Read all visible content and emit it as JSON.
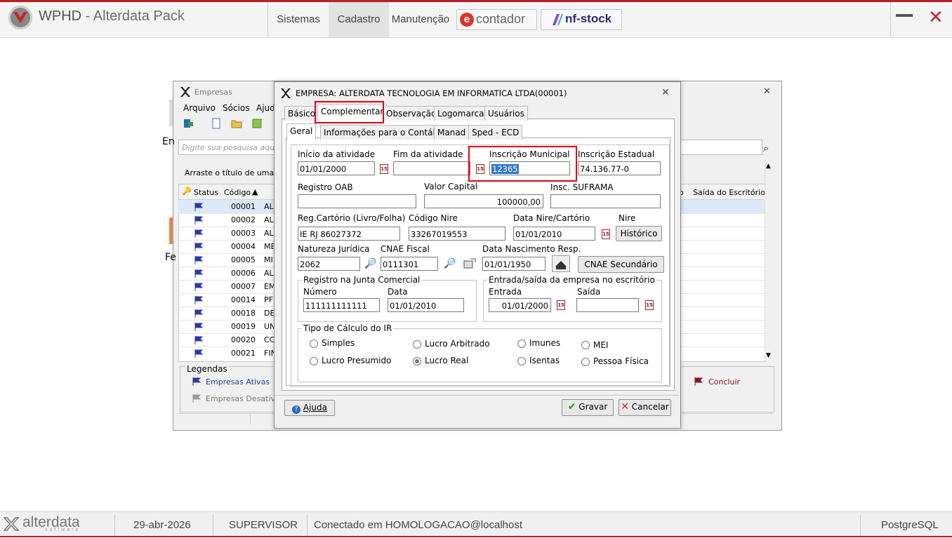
{
  "app": {
    "title_bold": "WPHD",
    "title_rest": " - Alterdata Pack"
  },
  "nav": {
    "sistemas": "Sistemas",
    "cadastro": "Cadastro",
    "manutencao": "Manutenção",
    "contador": "contador",
    "nfstock": "nf-stock"
  },
  "empresas_window": {
    "title": "Empresas",
    "menu": [
      "Arquivo",
      "Sócios",
      "Ajud"
    ],
    "search_placeholder": "Digite sua pesquisa aqui...",
    "group_hint": "Arraste o título de uma colu",
    "columns": {
      "status": "Status",
      "codigo": "Código",
      "saida": "Saída do Escritório",
      "partial": "o"
    },
    "left_partial_1": "En",
    "left_partial_2": "Fe",
    "rows": [
      {
        "codigo": "00001",
        "nome": "AL"
      },
      {
        "codigo": "00002",
        "nome": "AL"
      },
      {
        "codigo": "00003",
        "nome": "AL"
      },
      {
        "codigo": "00004",
        "nome": "ME"
      },
      {
        "codigo": "00005",
        "nome": "MI"
      },
      {
        "codigo": "00006",
        "nome": "AL"
      },
      {
        "codigo": "00007",
        "nome": "EM"
      },
      {
        "codigo": "00014",
        "nome": "PF"
      },
      {
        "codigo": "00018",
        "nome": "DE"
      },
      {
        "codigo": "00019",
        "nome": "UN"
      },
      {
        "codigo": "00020",
        "nome": "CC"
      },
      {
        "codigo": "00021",
        "nome": "FIN"
      }
    ],
    "legend_title": "Legendas",
    "legend_active": "Empresas Ativas",
    "legend_inactive": "Empresas Desativad",
    "concluir": "Concluir"
  },
  "dialog": {
    "title": "EMPRESA: ALTERDATA TECNOLOGIA EM INFORMATICA LTDA(00001)",
    "tabs": [
      "Básico",
      "Complementar",
      "Observação",
      "Logomarca",
      "Usuários"
    ],
    "subtabs": [
      "Geral",
      "Informações para o Contábil",
      "Manad",
      "Sped - ECD"
    ],
    "fields": {
      "inicio_label": "Início da atividade",
      "inicio_value": "01/01/2000",
      "fim_label": "Fim da atividade",
      "fim_value": "",
      "im_label": "Inscrição Municipal",
      "im_value": "12365",
      "ie_label": "Inscrição Estadual",
      "ie_value": "74.136.77-0",
      "oab_label": "Registro OAB",
      "oab_value": "",
      "capital_label": "Valor Capital",
      "capital_value": "100000,00",
      "suframa_label": "Insc. SUFRAMA",
      "suframa_value": "",
      "cartorio_label": "Reg.Cartório (Livro/Folha)",
      "cartorio_value": "IE RJ 86027372",
      "nire_label": "Código Nire",
      "nire_value": "33267019553",
      "data_nire_label": "Data Nire/Cartório",
      "data_nire_value": "01/01/2010",
      "nire_hist_label": "Nire",
      "historico_btn": "Histórico",
      "natureza_label": "Natureza Jurídica",
      "natureza_value": "2062",
      "cnae_label": "CNAE Fiscal",
      "cnae_value": "0111301",
      "nasc_label": "Data Nascimento Resp.",
      "nasc_value": "01/01/1950",
      "cnae_sec_btn": "CNAE Secundário"
    },
    "junta": {
      "title": "Registro na Junta Comercial",
      "numero_label": "Número",
      "numero_value": "111111111111",
      "data_label": "Data",
      "data_value": "01/01/2010"
    },
    "escritorio": {
      "title": "Entrada/saída da empresa no escritório",
      "entrada_label": "Entrada",
      "entrada_value": "01/01/2000",
      "saida_label": "Saída",
      "saida_value": ""
    },
    "ir": {
      "title": "Tipo de Cálculo do IR",
      "options": [
        "Simples",
        "Lucro Arbitrado",
        "Imunes",
        "MEI",
        "Lucro Presumido",
        "Lucro Real",
        "Isentas",
        "Pessoa Física"
      ],
      "selected": "Lucro Real"
    },
    "buttons": {
      "ajuda": "Ajuda",
      "gravar": "Gravar",
      "cancelar": "Cancelar"
    }
  },
  "status": {
    "brand": "alterdata",
    "brand_sub": "software",
    "date": "29-abr-2026",
    "user": "SUPERVISOR",
    "connection": "Conectado em HOMOLOGACAO@localhost",
    "db": "PostgreSQL"
  },
  "colors": {
    "accent_red": "#b4202a",
    "highlight": "#e0000f",
    "selection": "#3377cc"
  }
}
